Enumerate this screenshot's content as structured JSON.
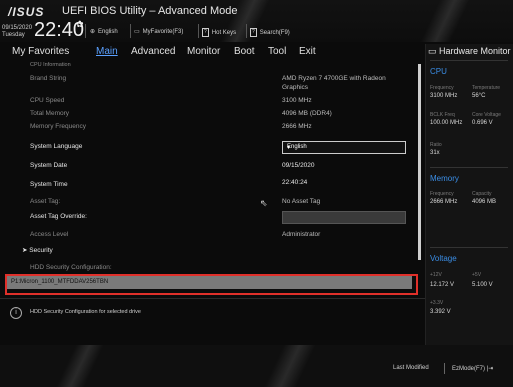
{
  "header": {
    "logo": "/ISUS",
    "title": "UEFI BIOS Utility – Advanced Mode",
    "date_line1": "09/15/2020",
    "date_line2": "Tuesday",
    "time": "22:40",
    "language": "English",
    "myfavorite": "MyFavorite(F3)",
    "hotkeys": "Hot Keys",
    "search": "Search(F9)"
  },
  "menu": {
    "items": [
      "My Favorites",
      "Main",
      "Advanced",
      "Monitor",
      "Boot",
      "Tool",
      "Exit"
    ],
    "active": "Main"
  },
  "main": {
    "section_header": "CPU Information",
    "rows": [
      {
        "label": "Brand String",
        "value": "AMD Ryzen 7 4700GE with Radeon",
        "value2": "Graphics"
      },
      {
        "label": "CPU Speed",
        "value": "3100 MHz"
      },
      {
        "label": "Total Memory",
        "value": "4096 MB (DDR4)"
      },
      {
        "label": "Memory Frequency",
        "value": "2666 MHz"
      },
      {
        "label": "System Language",
        "value": "English"
      },
      {
        "label": "System Date",
        "value": "09/15/2020"
      },
      {
        "label": "System Time",
        "value": "22:40:24"
      },
      {
        "label": "Asset Tag:",
        "value": "No Asset Tag"
      },
      {
        "label": "Asset Tag Override:",
        "value": ""
      },
      {
        "label": "Access Level",
        "value": "Administrator"
      },
      {
        "label": "Security",
        "value": ""
      },
      {
        "label": "HDD Security Configuration:",
        "value": ""
      }
    ],
    "selected_item": "P1:Micron_1100_MTFDDAV256TBN",
    "help_text": "HDD Security Configuration for selected drive"
  },
  "hw_monitor": {
    "title": "Hardware Monitor",
    "cpu": {
      "title": "CPU",
      "frequency_label": "Frequency",
      "frequency": "3100 MHz",
      "temperature_label": "Temperature",
      "temperature": "56°C",
      "bclk_label": "BCLK Freq",
      "bclk": "100.00 MHz",
      "core_voltage_label": "Core Voltage",
      "core_voltage": "0.696 V",
      "ratio_label": "Ratio",
      "ratio": "31x"
    },
    "memory": {
      "title": "Memory",
      "frequency_label": "Frequency",
      "frequency": "2666 MHz",
      "capacity_label": "Capacity",
      "capacity": "4096 MB"
    },
    "voltage": {
      "title": "Voltage",
      "v12_label": "+12V",
      "v12": "12.172 V",
      "v5_label": "+5V",
      "v5": "5.100 V",
      "v33_label": "+3.3V",
      "v33": "3.392 V"
    }
  },
  "footer": {
    "last_modified": "Last Modified",
    "ezmode": "EzMode(F7)"
  },
  "colors": {
    "accent": "#3b8ee6",
    "highlight_border": "#e0302a"
  },
  "icons": [
    "globe-icon",
    "favorite-icon",
    "hotkeys-icon",
    "search-icon",
    "gear-icon",
    "info-icon",
    "exit-icon",
    "pointer-cursor-icon"
  ]
}
